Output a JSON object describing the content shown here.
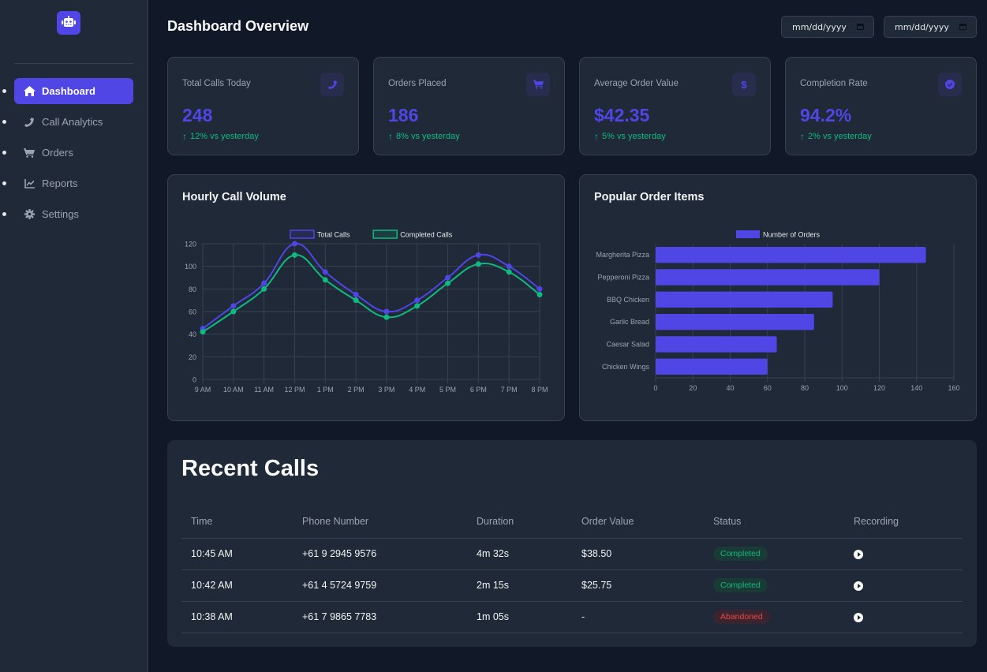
{
  "app": {
    "logo_icon": "robot-icon"
  },
  "sidebar": {
    "items": [
      {
        "label": "Dashboard",
        "icon": "home-icon",
        "active": true
      },
      {
        "label": "Call Analytics",
        "icon": "phone-icon",
        "active": false
      },
      {
        "label": "Orders",
        "icon": "cart-icon",
        "active": false
      },
      {
        "label": "Reports",
        "icon": "chart-line-icon",
        "active": false
      },
      {
        "label": "Settings",
        "icon": "gear-icon",
        "active": false
      }
    ]
  },
  "header": {
    "title": "Dashboard Overview",
    "date_from_placeholder": "mm/dd/yyyy",
    "date_to_placeholder": "mm/dd/yyyy"
  },
  "stats": [
    {
      "label": "Total Calls Today",
      "value": "248",
      "change": "12% vs yesterday",
      "icon": "phone-icon"
    },
    {
      "label": "Orders Placed",
      "value": "186",
      "change": "8% vs yesterday",
      "icon": "cart-icon"
    },
    {
      "label": "Average Order Value",
      "value": "$42.35",
      "change": "5% vs yesterday",
      "icon": "dollar-icon",
      "icon_glyph": "$"
    },
    {
      "label": "Completion Rate",
      "value": "94.2%",
      "change": "2% vs yesterday",
      "icon": "check-circle-icon"
    }
  ],
  "colors": {
    "accent": "#4f46e5",
    "success": "#10b981",
    "danger": "#ef4444",
    "grid": "#374151",
    "tick": "#9ca3af"
  },
  "chart_data": [
    {
      "type": "line",
      "title": "Hourly Call Volume",
      "categories": [
        "9 AM",
        "10 AM",
        "11 AM",
        "12 PM",
        "1 PM",
        "2 PM",
        "3 PM",
        "4 PM",
        "5 PM",
        "6 PM",
        "7 PM",
        "8 PM"
      ],
      "series": [
        {
          "name": "Total Calls",
          "color": "#4f46e5",
          "values": [
            45,
            65,
            85,
            120,
            95,
            75,
            60,
            70,
            90,
            110,
            100,
            80
          ]
        },
        {
          "name": "Completed Calls",
          "color": "#10b981",
          "values": [
            42,
            60,
            80,
            110,
            88,
            70,
            55,
            65,
            85,
            102,
            95,
            75
          ]
        }
      ],
      "yticks": [
        0,
        20,
        40,
        60,
        80,
        100,
        120
      ],
      "ylim": [
        0,
        120
      ],
      "grid": true,
      "legend": "top-center",
      "xlabel": "",
      "ylabel": ""
    },
    {
      "type": "bar",
      "orientation": "horizontal",
      "title": "Popular Order Items",
      "categories": [
        "Margherita Pizza",
        "Pepperoni Pizza",
        "BBQ Chicken",
        "Garlic Bread",
        "Caesar Salad",
        "Chicken Wings"
      ],
      "series": [
        {
          "name": "Number of Orders",
          "color": "#4f46e5",
          "values": [
            145,
            120,
            95,
            85,
            65,
            60
          ]
        }
      ],
      "xticks": [
        0,
        20,
        40,
        60,
        80,
        100,
        120,
        140,
        160
      ],
      "xlim": [
        0,
        160
      ],
      "grid": true,
      "legend": "top-center",
      "xlabel": "",
      "ylabel": ""
    }
  ],
  "recent_calls": {
    "title": "Recent Calls",
    "columns": [
      "Time",
      "Phone Number",
      "Duration",
      "Order Value",
      "Status",
      "Recording"
    ],
    "rows": [
      {
        "time": "10:45 AM",
        "phone": "+61 9 2945 9576",
        "duration": "4m 32s",
        "order_value": "$38.50",
        "status": "Completed",
        "status_type": "completed"
      },
      {
        "time": "10:42 AM",
        "phone": "+61 4 5724 9759",
        "duration": "2m 15s",
        "order_value": "$25.75",
        "status": "Completed",
        "status_type": "completed"
      },
      {
        "time": "10:38 AM",
        "phone": "+61 7 9865 7783",
        "duration": "1m 05s",
        "order_value": "-",
        "status": "Abandoned",
        "status_type": "abandoned"
      }
    ]
  }
}
